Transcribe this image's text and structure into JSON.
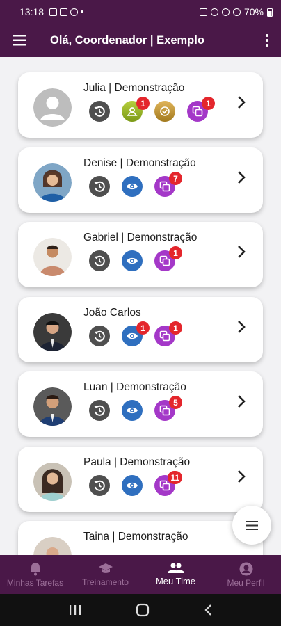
{
  "status_bar": {
    "time": "13:18",
    "battery": "70%"
  },
  "app_bar": {
    "title": "Olá, Coordenador | Exemplo"
  },
  "members": [
    {
      "name": "Julia | Demonstração",
      "avatar": "default",
      "icons": [
        {
          "type": "history",
          "badge": ""
        },
        {
          "type": "pin",
          "badge": "1"
        },
        {
          "type": "check",
          "badge": ""
        },
        {
          "type": "copy",
          "badge": "1"
        }
      ]
    },
    {
      "name": "Denise | Demonstração",
      "avatar": "photo",
      "icons": [
        {
          "type": "history",
          "badge": ""
        },
        {
          "type": "eye",
          "badge": ""
        },
        {
          "type": "copy",
          "badge": "7"
        }
      ]
    },
    {
      "name": "Gabriel | Demonstração",
      "avatar": "photo",
      "icons": [
        {
          "type": "history",
          "badge": ""
        },
        {
          "type": "eye",
          "badge": ""
        },
        {
          "type": "copy",
          "badge": "1"
        }
      ]
    },
    {
      "name": "João Carlos",
      "avatar": "photo",
      "icons": [
        {
          "type": "history",
          "badge": ""
        },
        {
          "type": "eye",
          "badge": "1"
        },
        {
          "type": "copy",
          "badge": "1"
        }
      ]
    },
    {
      "name": "Luan | Demonstração",
      "avatar": "photo",
      "icons": [
        {
          "type": "history",
          "badge": ""
        },
        {
          "type": "eye",
          "badge": ""
        },
        {
          "type": "copy",
          "badge": "5"
        }
      ]
    },
    {
      "name": "Paula | Demonstração",
      "avatar": "photo",
      "icons": [
        {
          "type": "history",
          "badge": ""
        },
        {
          "type": "eye",
          "badge": ""
        },
        {
          "type": "copy",
          "badge": "11"
        }
      ]
    },
    {
      "name": "Taina | Demonstração",
      "avatar": "photo",
      "icons": []
    }
  ],
  "bottom_nav": [
    {
      "label": "Minhas Tarefas",
      "icon": "bell-icon",
      "active": false
    },
    {
      "label": "Treinamento",
      "icon": "graduation-cap-icon",
      "active": false
    },
    {
      "label": "Meu Time",
      "icon": "people-icon",
      "active": true
    },
    {
      "label": "Meu Perfil",
      "icon": "person-icon",
      "active": false
    }
  ],
  "colors": {
    "primary": "#4a1848",
    "badge": "#e4262c",
    "history": "#4f4f4f",
    "eye": "#2f6fbf",
    "copy": "#a438c8",
    "pin": "#9bb62a",
    "check": "#c4983a"
  }
}
